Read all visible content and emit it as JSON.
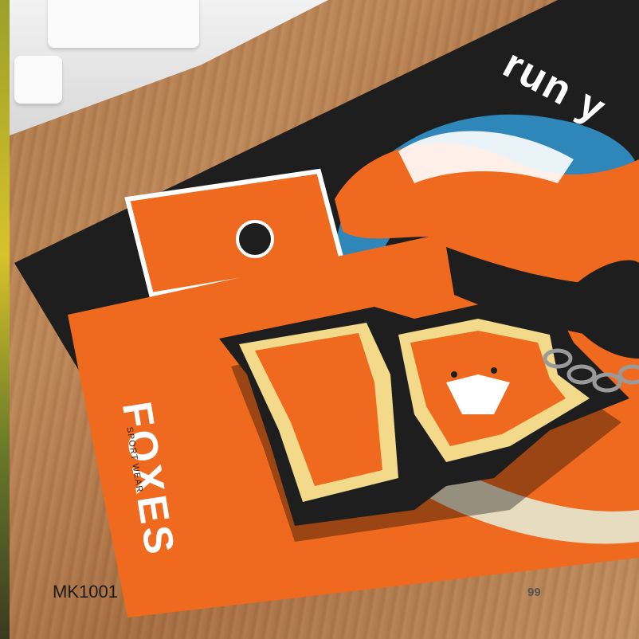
{
  "product_code": "MK1001",
  "page_number": "99",
  "card_front": {
    "brand": "FOXES",
    "tagline": "SPORT WEAR"
  },
  "card_back": {
    "partial_text": "run y"
  },
  "keychain_text": "FOXES",
  "colors": {
    "orange": "#ef6a1f",
    "black": "#1e1e1e",
    "cream": "#f3d98a",
    "wood": "#b07a4c"
  }
}
